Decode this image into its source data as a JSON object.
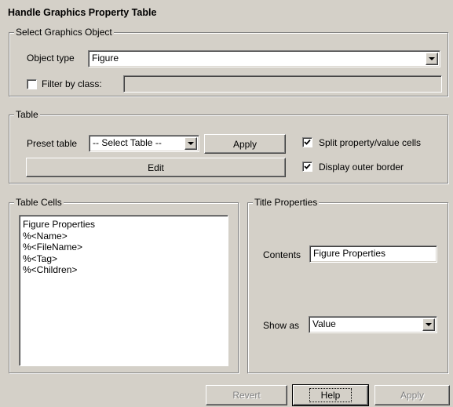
{
  "window": {
    "title": "Handle Graphics Property Table"
  },
  "select_object": {
    "legend": "Select Graphics Object",
    "object_type_label": "Object type",
    "object_type_value": "Figure",
    "filter_label": "Filter by class:",
    "filter_checked": false,
    "filter_value": ""
  },
  "table": {
    "legend": "Table",
    "preset_label": "Preset table",
    "preset_value": "-- Select Table --",
    "apply_label": "Apply",
    "edit_label": "Edit",
    "split_label": "Split property/value cells",
    "split_checked": true,
    "border_label": "Display outer border",
    "border_checked": true
  },
  "table_cells": {
    "legend": "Table Cells",
    "items": [
      "Figure Properties",
      "%<Name>",
      "%<FileName>",
      "%<Tag>",
      "%<Children>"
    ]
  },
  "title_properties": {
    "legend": "Title Properties",
    "contents_label": "Contents",
    "contents_value": "Figure Properties",
    "show_as_label": "Show as",
    "show_as_value": "Value"
  },
  "footer": {
    "revert_label": "Revert",
    "help_label": "Help",
    "apply_label": "Apply"
  }
}
